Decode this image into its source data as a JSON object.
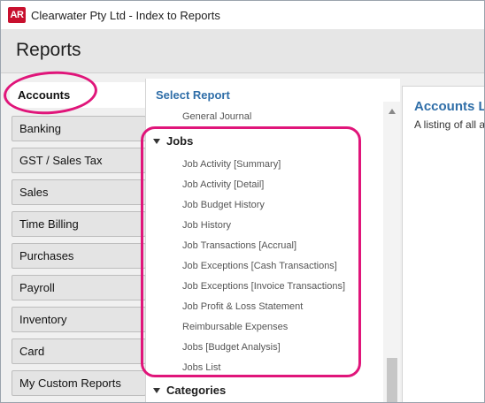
{
  "window": {
    "app_icon": "AR",
    "title": "Clearwater Pty Ltd - Index to Reports"
  },
  "header": {
    "title": "Reports"
  },
  "sidebar": {
    "items": [
      {
        "label": "Accounts",
        "active": true
      },
      {
        "label": "Banking"
      },
      {
        "label": "GST / Sales Tax"
      },
      {
        "label": "Sales"
      },
      {
        "label": "Time Billing"
      },
      {
        "label": "Purchases"
      },
      {
        "label": "Payroll"
      },
      {
        "label": "Inventory"
      },
      {
        "label": "Card"
      },
      {
        "label": "My Custom Reports"
      }
    ]
  },
  "select_report": {
    "title": "Select Report",
    "top_item": "General Journal",
    "groups": [
      {
        "label": "Jobs",
        "expanded": true,
        "items": [
          "Job Activity [Summary]",
          "Job Activity [Detail]",
          "Job Budget History",
          "Job History",
          "Job Transactions [Accrual]",
          "Job Exceptions [Cash Transactions]",
          "Job Exceptions [Invoice Transactions]",
          "Job Profit & Loss Statement",
          "Reimbursable Expenses",
          "Jobs [Budget Analysis]",
          "Jobs List"
        ]
      },
      {
        "label": "Categories",
        "expanded": true
      }
    ]
  },
  "detail": {
    "title": "Accounts L",
    "description": "A listing of all a"
  },
  "colors": {
    "accent_blue": "#2f6ea8",
    "highlight_pink": "#e0157a",
    "app_icon_red": "#c8102e"
  }
}
